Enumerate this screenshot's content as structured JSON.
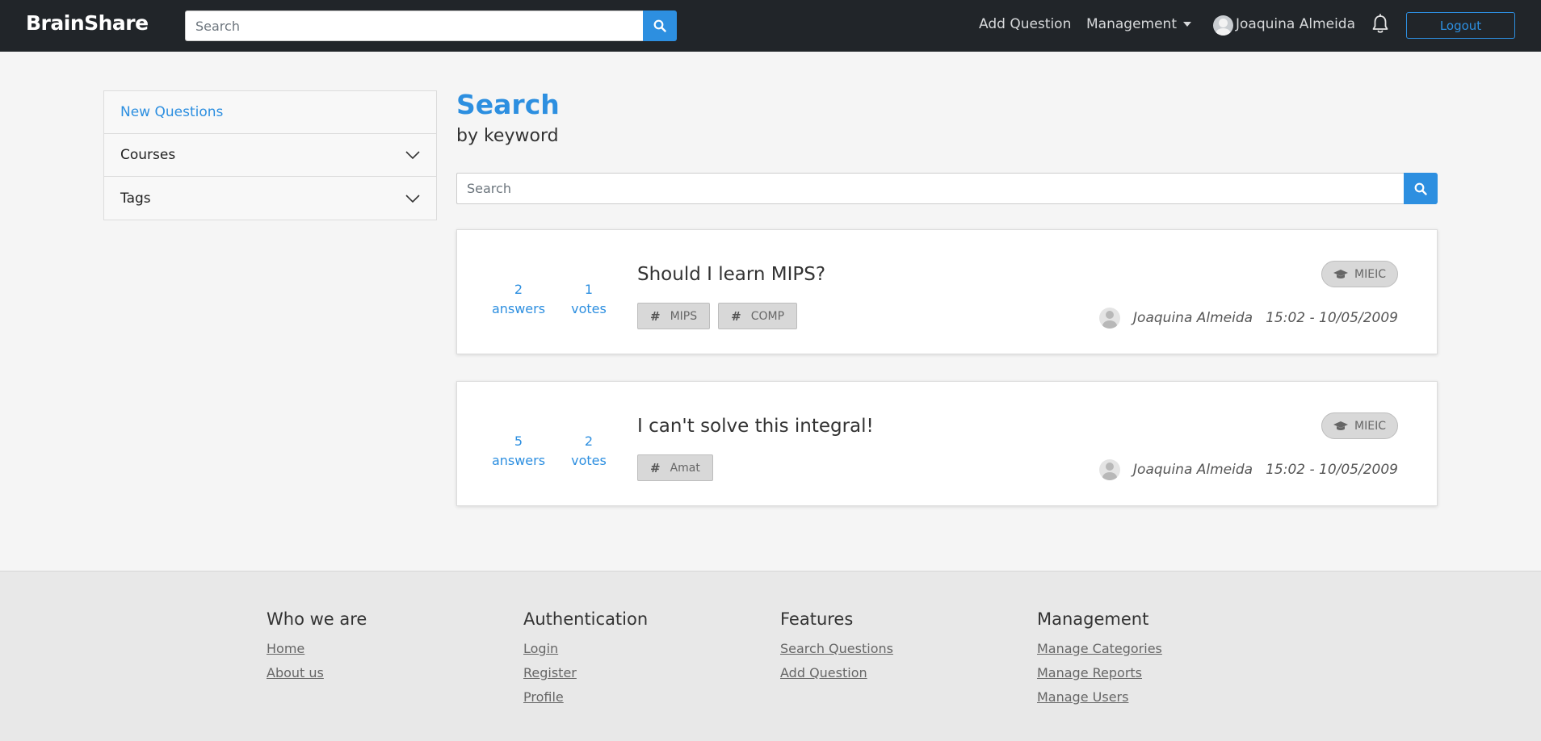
{
  "navbar": {
    "brand": "BrainShare",
    "search_placeholder": "Search",
    "add_question": "Add Question",
    "management": "Management",
    "user_name": "Joaquina Almeida",
    "logout": "Logout"
  },
  "sidebar": {
    "items": [
      {
        "label": "New Questions"
      },
      {
        "label": "Courses"
      },
      {
        "label": "Tags"
      }
    ]
  },
  "main": {
    "title": "Search",
    "subtitle": "by keyword",
    "search_placeholder": "Search",
    "questions": [
      {
        "answers": "2",
        "answers_label": "answers",
        "votes": "1",
        "votes_label": "votes",
        "title": "Should I learn MIPS?",
        "tags": [
          "MIPS",
          "COMP"
        ],
        "course": "MIEIC",
        "author": "Joaquina Almeida",
        "date": "15:02 - 10/05/2009"
      },
      {
        "answers": "5",
        "answers_label": "answers",
        "votes": "2",
        "votes_label": "votes",
        "title": "I can't solve this integral!",
        "tags": [
          "Amat"
        ],
        "course": "MIEIC",
        "author": "Joaquina Almeida",
        "date": "15:02 - 10/05/2009"
      }
    ]
  },
  "footer": {
    "columns": [
      {
        "heading": "Who we are",
        "links": [
          "Home",
          "About us"
        ]
      },
      {
        "heading": "Authentication",
        "links": [
          "Login",
          "Register",
          "Profile"
        ]
      },
      {
        "heading": "Features",
        "links": [
          "Search Questions",
          "Add Question"
        ]
      },
      {
        "heading": "Management",
        "links": [
          "Manage Categories",
          "Manage Reports",
          "Manage Users"
        ]
      }
    ]
  },
  "colors": {
    "accent": "#2d8fe0",
    "navbar_bg": "#212529",
    "page_bg": "#f5f5f5",
    "footer_bg": "#e8e8e8"
  }
}
